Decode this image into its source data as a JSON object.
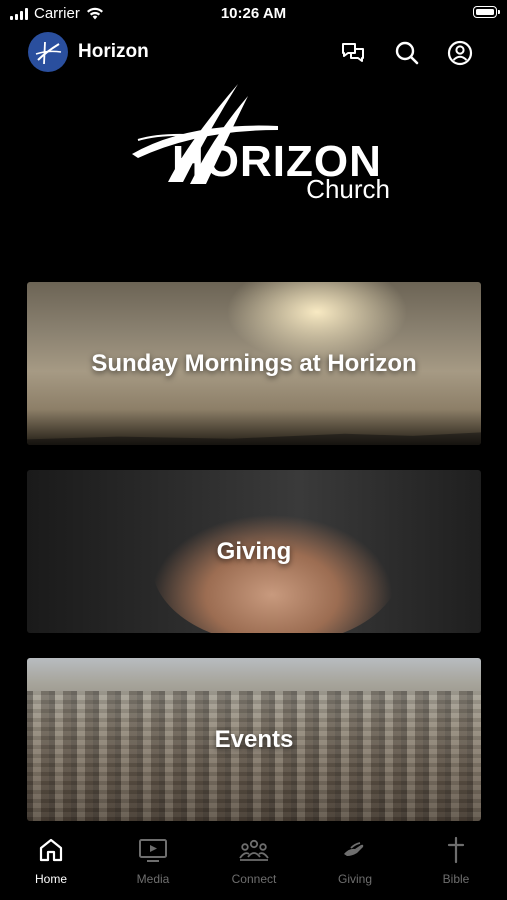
{
  "status_bar": {
    "carrier": "Carrier",
    "time": "10:26 AM"
  },
  "header": {
    "title": "Horizon",
    "icons": [
      "chat-icon",
      "search-icon",
      "profile-icon"
    ]
  },
  "logo": {
    "brand_name": "HORIZON",
    "sub_name": "Church"
  },
  "cards": [
    {
      "label": "Sunday Mornings at Horizon"
    },
    {
      "label": "Giving"
    },
    {
      "label": "Events"
    }
  ],
  "tabbar": {
    "active": "Home",
    "items": [
      {
        "label": "Home",
        "icon": "home-icon"
      },
      {
        "label": "Media",
        "icon": "media-icon"
      },
      {
        "label": "Connect",
        "icon": "connect-icon"
      },
      {
        "label": "Giving",
        "icon": "giving-icon"
      },
      {
        "label": "Bible",
        "icon": "cross-icon"
      }
    ]
  },
  "colors": {
    "background": "#000000",
    "active_tab": "#ffffff",
    "inactive_tab": "#6e6e6e",
    "avatar": "#2a4f9e"
  }
}
